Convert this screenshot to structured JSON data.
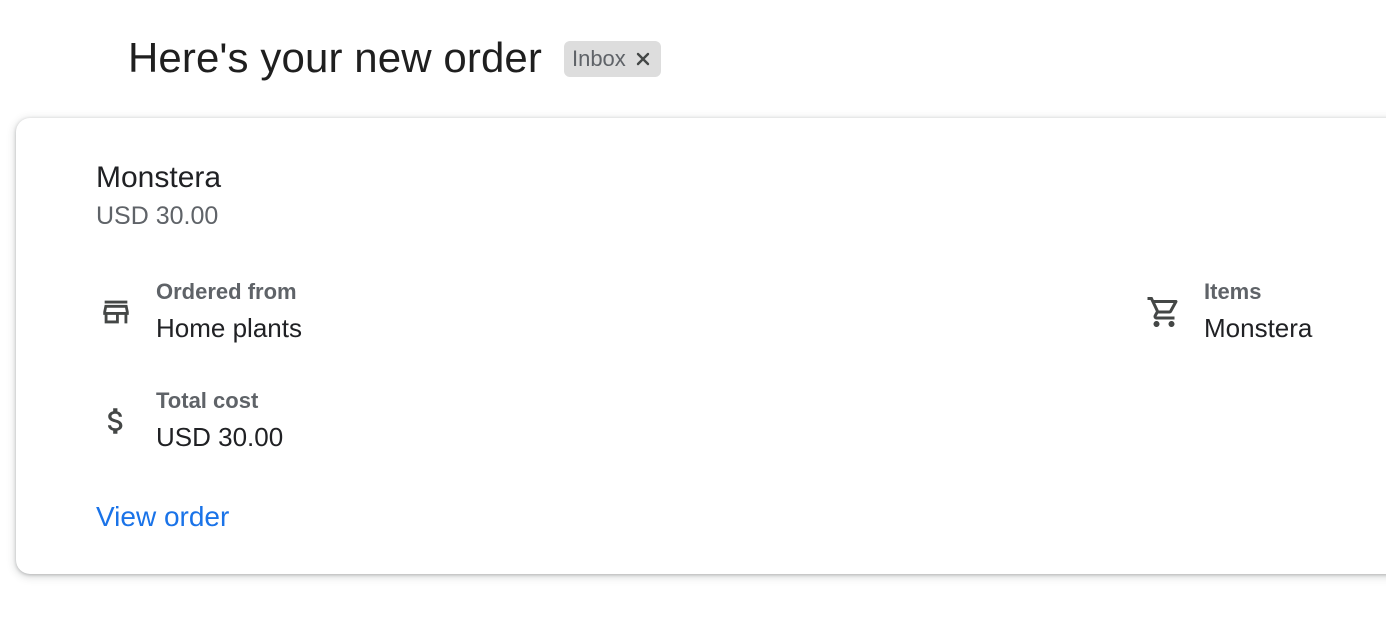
{
  "email": {
    "subject": "Here's your new order",
    "label_chip": {
      "text": "Inbox",
      "close_icon": "close-icon"
    }
  },
  "order_card": {
    "product_name": "Monstera",
    "product_price": "USD 30.00",
    "details": {
      "ordered_from": {
        "icon": "store-icon",
        "label": "Ordered from",
        "value": "Home plants"
      },
      "total_cost": {
        "icon": "dollar-icon",
        "label": "Total cost",
        "value": "USD 30.00"
      },
      "items": {
        "icon": "shopping-cart-icon",
        "label": "Items",
        "value": "Monstera"
      }
    },
    "view_order_label": "View order"
  },
  "colors": {
    "link": "#1a73e8",
    "secondary_text": "#5f6368",
    "primary_text": "#202124",
    "chip_background": "#dddddd"
  }
}
